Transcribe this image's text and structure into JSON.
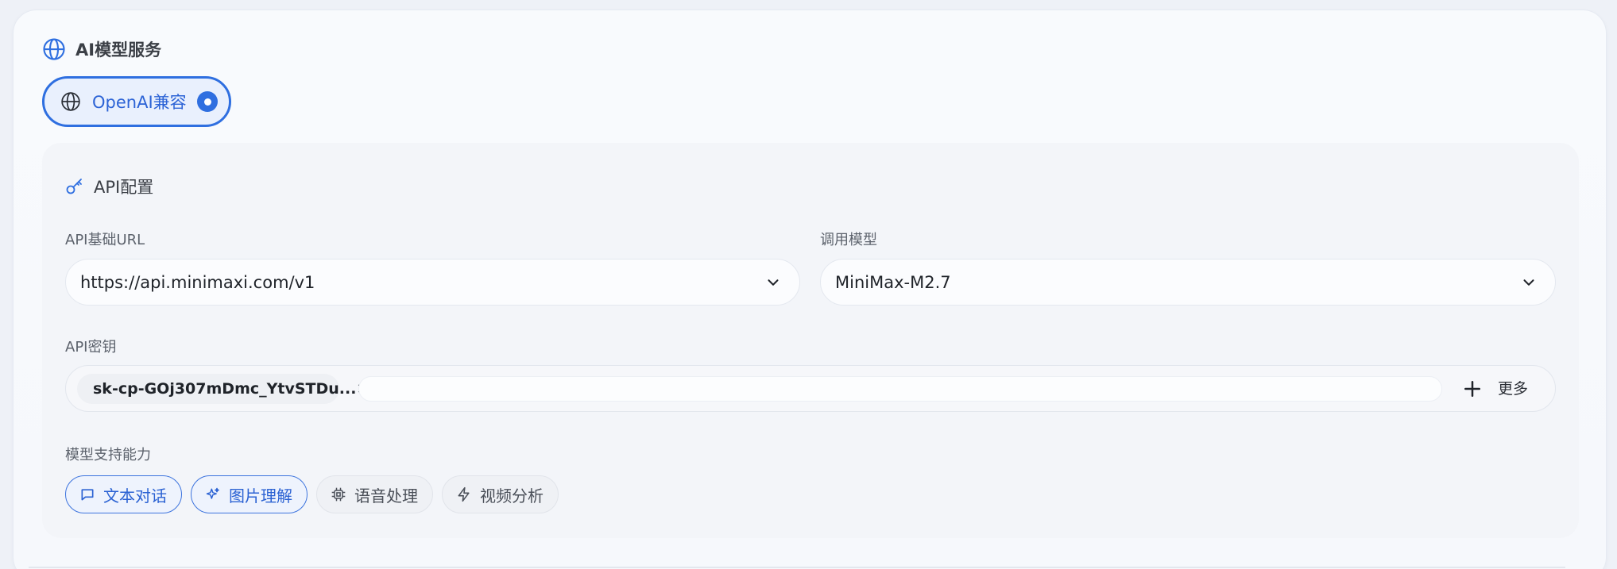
{
  "section": {
    "title": "AI模型服务",
    "icon": "globe-icon"
  },
  "provider": {
    "label": "OpenAI兼容",
    "selected": true,
    "icon": "globe-icon"
  },
  "config": {
    "title": "API配置",
    "icon": "key-icon",
    "base_url": {
      "label": "API基础URL",
      "value": "https://api.minimaxi.com/v1"
    },
    "model": {
      "label": "调用模型",
      "value": "MiniMax-M2.7"
    },
    "api_key": {
      "label": "API密钥",
      "chips": [
        "sk-cp-GOj307mDmc_YtvSTDu..."
      ],
      "input_value": "",
      "more_label": "更多"
    },
    "capabilities": {
      "label": "模型支持能力",
      "items": [
        {
          "label": "文本对话",
          "icon": "chat-bubble-icon",
          "enabled": true
        },
        {
          "label": "图片理解",
          "icon": "sparkles-icon",
          "enabled": true
        },
        {
          "label": "语音处理",
          "icon": "chip-icon",
          "enabled": false
        },
        {
          "label": "视频分析",
          "icon": "lightning-icon",
          "enabled": false
        }
      ]
    }
  },
  "colors": {
    "accent": "#2f6fe0",
    "accent_text": "#2c63d6",
    "background": "#eef1f7"
  }
}
